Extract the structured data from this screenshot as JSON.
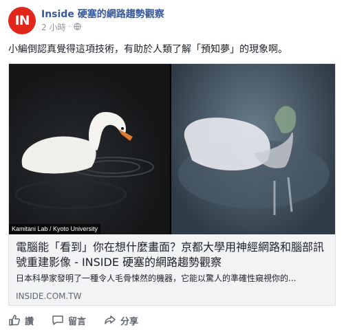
{
  "header": {
    "avatar_text": "IN",
    "page_name": "Inside 硬塞的網路趨勢觀察",
    "time": "2 小時",
    "privacy_icon": "globe-icon"
  },
  "post": {
    "text": "小編倒認真覺得這項技術，有助於人類了解「預知夢」的現象啊。"
  },
  "card": {
    "image_credit": "Kamitani Lab / Kyoto University",
    "title": "電腦能「看到」你在想什麼畫面？京都大學用神經網路和腦部訊號重建影像 - INSIDE 硬塞的網路趨勢觀察",
    "description": "日本科學家發明了一種令人毛骨悚然的機器，它能以驚人的準確性窺視你的...",
    "domain": "INSIDE.COM.TW"
  },
  "actions": {
    "like": "讚",
    "comment": "留言",
    "share": "分享"
  },
  "colors": {
    "avatar_bg": "#e1261c",
    "link": "#365899",
    "muted": "#90949c",
    "action": "#606770"
  }
}
